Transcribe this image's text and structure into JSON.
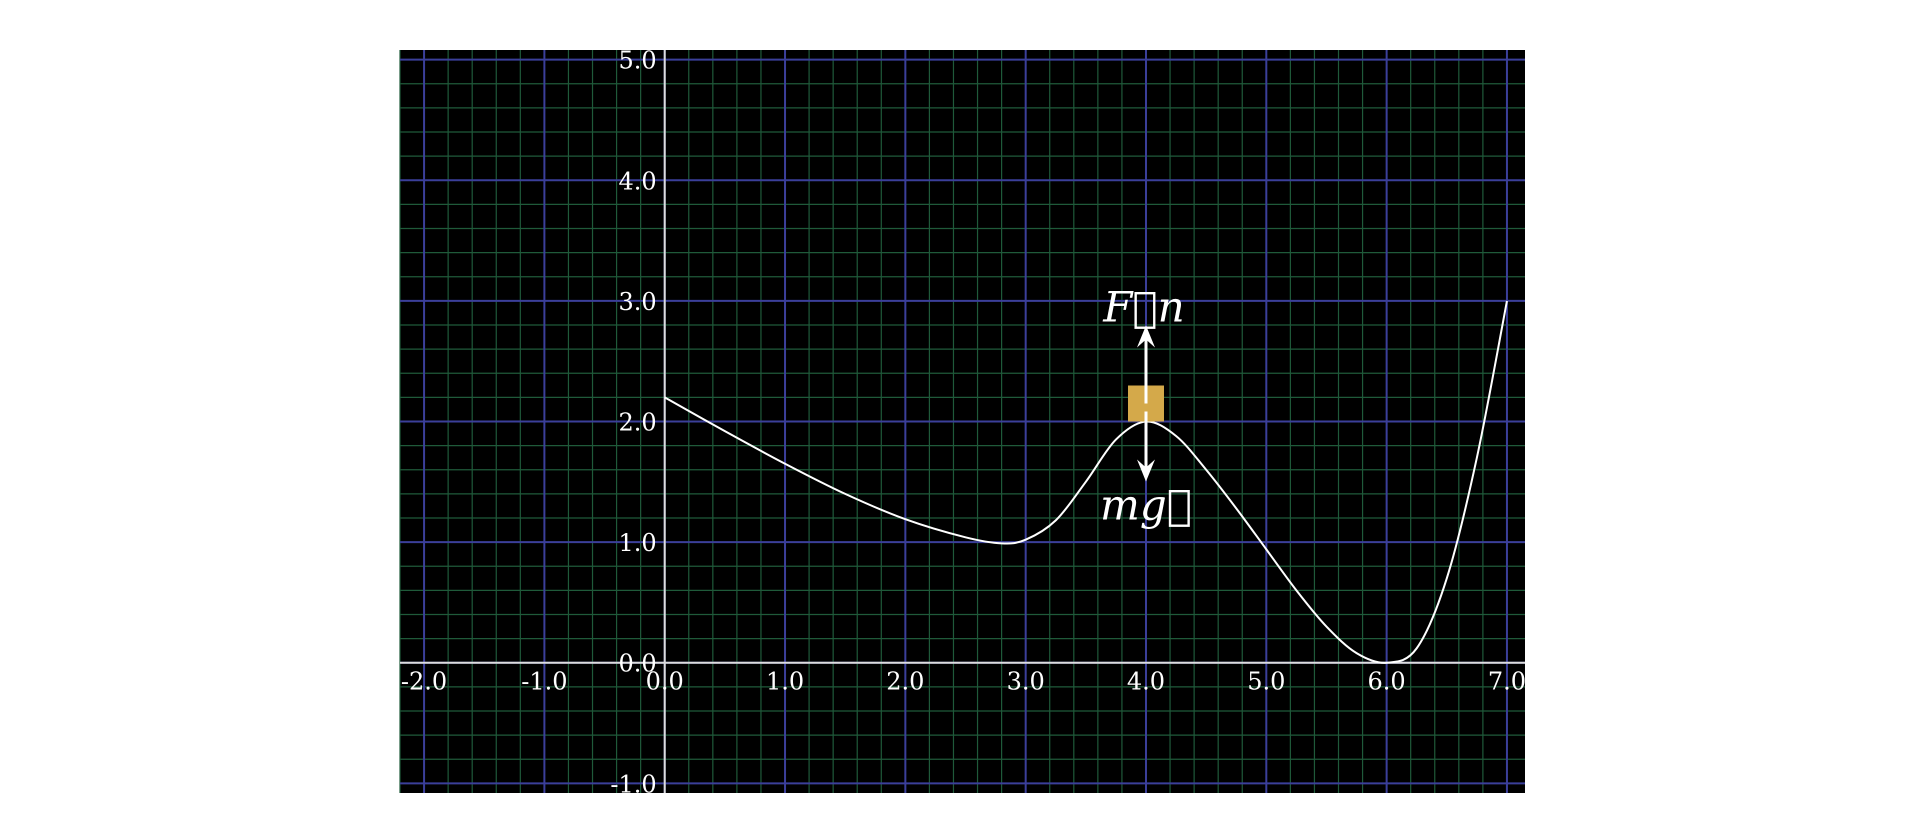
{
  "chart_data": {
    "type": "line",
    "xlim": [
      -2.2,
      7.15
    ],
    "ylim": [
      -1.08,
      5.08
    ],
    "grid": true,
    "x_ticks": [
      -2.0,
      -1.0,
      0.0,
      1.0,
      2.0,
      3.0,
      4.0,
      5.0,
      6.0,
      7.0
    ],
    "x_tick_labels": [
      "-2.0",
      "-1.0",
      "0.0",
      "1.0",
      "2.0",
      "3.0",
      "4.0",
      "5.0",
      "6.0",
      "7.0"
    ],
    "y_ticks": [
      -1.0,
      0.0,
      1.0,
      2.0,
      3.0,
      4.0,
      5.0
    ],
    "y_tick_labels": [
      "-1.0",
      "0.0",
      "1.0",
      "2.0",
      "3.0",
      "4.0",
      "5.0"
    ],
    "series": [
      {
        "color": "#ffffff",
        "x": [
          0.0,
          0.5,
          1.0,
          1.5,
          2.0,
          2.5,
          2.8,
          3.0,
          3.25,
          3.5,
          3.75,
          4.0,
          4.25,
          4.5,
          4.75,
          5.0,
          5.25,
          5.5,
          5.75,
          6.0,
          6.25,
          6.5,
          6.75,
          7.0
        ],
        "y": [
          2.2,
          1.92,
          1.65,
          1.4,
          1.19,
          1.04,
          0.99,
          1.02,
          1.18,
          1.5,
          1.85,
          2.0,
          1.88,
          1.6,
          1.28,
          0.94,
          0.6,
          0.3,
          0.08,
          0.0,
          0.12,
          0.7,
          1.7,
          3.0
        ]
      }
    ],
    "object": {
      "type": "block",
      "x": 4.0,
      "y": 2.0,
      "color": "#d4a94a",
      "normal_force_label": "F⃗n",
      "gravity_label": "mg⃗"
    },
    "colors": {
      "background": "#000000",
      "major_grid": "#3b3f9a",
      "minor_grid": "#1f5a3a",
      "axis": "#dddddd",
      "curve": "#ffffff",
      "arrow": "#ffffff"
    }
  }
}
